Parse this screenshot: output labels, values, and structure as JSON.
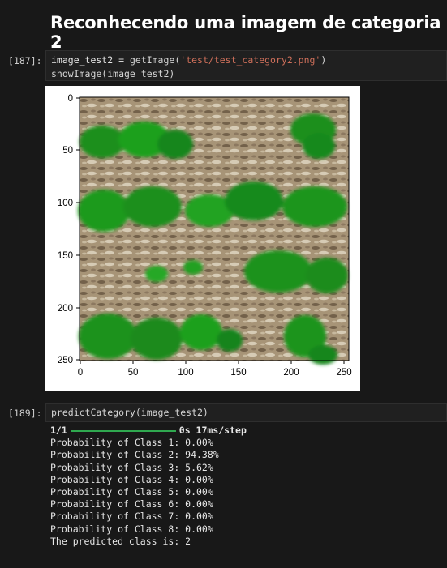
{
  "heading": "Reconhecendo uma imagem de categoria 2",
  "cell1": {
    "prompt": "[187]:",
    "line1": {
      "var": "image_test2",
      "op": " = getImage(",
      "str": "'test/test_category2.png'",
      "close": ")"
    },
    "line2": "showImage(image_test2)"
  },
  "plot": {
    "x_ticks": [
      "0",
      "50",
      "100",
      "150",
      "200",
      "250"
    ],
    "y_ticks": [
      "0",
      "50",
      "100",
      "150",
      "200",
      "250"
    ]
  },
  "cell2": {
    "prompt": "[189]:",
    "code": "predictCategory(image_test2)"
  },
  "output": {
    "progress_step": "1/1",
    "progress_timing": "0s 17ms/step",
    "lines": [
      "Probability of Class 1: 0.00%",
      "Probability of Class 2: 94.38%",
      "Probability of Class 3: 5.62%",
      "Probability of Class 4: 0.00%",
      "Probability of Class 5: 0.00%",
      "Probability of Class 6: 0.00%",
      "Probability of Class 7: 0.00%",
      "Probability of Class 8: 0.00%",
      "The predicted class is: 2"
    ]
  },
  "colors": {
    "background": "#181818",
    "string": "#ce6f5a",
    "progress_bar": "#2fa84f",
    "leaf_green": "#1e9a1e",
    "soil": "#a89478"
  }
}
